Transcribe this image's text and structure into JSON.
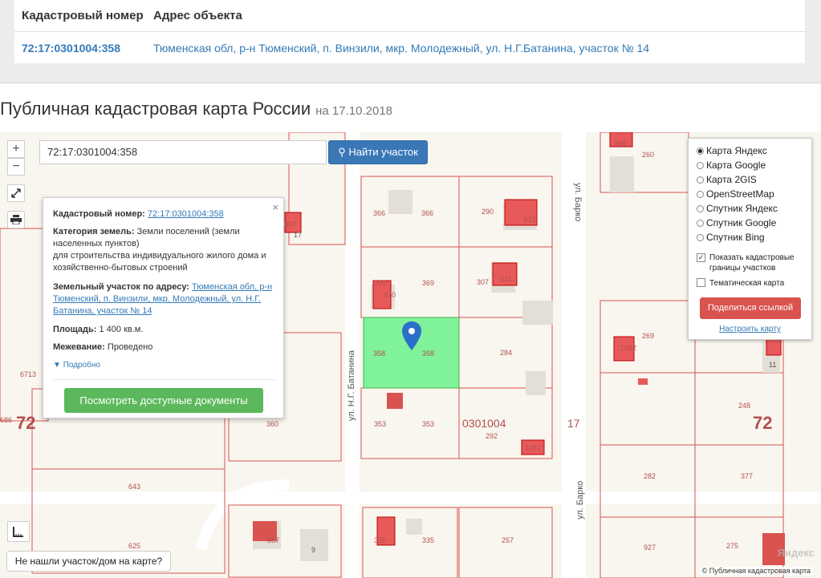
{
  "table": {
    "col_number": "Кадастровый номер",
    "col_address": "Адрес объекта",
    "row_number": "72:17:0301004:358",
    "row_address": "Тюменская обл, р-н Тюменский, п. Винзили, мкр. Молодежный, ул. Н.Г.Батанина, участок № 14"
  },
  "heading": {
    "title": "Публичная кадастровая карта России",
    "date": "на 17.10.2018"
  },
  "search": {
    "value": "72:17:0301004:358",
    "button": "Найти участок",
    "button_icon": "search-icon"
  },
  "zoom": {
    "plus": "+",
    "minus": "−"
  },
  "popup": {
    "close": "×",
    "number_label": "Кадастровый номер:",
    "number_value": "72:17:0301004:358",
    "category_label": "Категория земель:",
    "category_value": "Земли поселений (земли населенных пунктов)",
    "usage": "для строительства индивидуального жилого дома и хозяйственно-бытовых строений",
    "address_label": "Земельный участок по адресу:",
    "address_value": "Тюменская обл, р-н Тюменский, п. Винзили, мкр. Молодежный, ул. Н.Г. Батанина, участок № 14",
    "area_label": "Площадь:",
    "area_value": "1 400 кв.м.",
    "survey_label": "Межевание:",
    "survey_value": "Проведено",
    "more": "Подробно",
    "docs_button": "Посмотреть доступные документы"
  },
  "layers": {
    "options": [
      "Карта Яндекс",
      "Карта Google",
      "Карта 2GIS",
      "OpenStreetMap",
      "Спутник Яндекс",
      "Спутник Google",
      "Спутник Bing"
    ],
    "selected": "Карта Яндекс",
    "show_borders": "Показать кадастровые границы участков",
    "thematic": "Тематическая карта",
    "share_button": "Поделиться ссылкой",
    "customize": "Настроить карту"
  },
  "map_labels": {
    "street_batanina": "ул. Н.Г. Батанина",
    "street_barko_top": "ул. Барко",
    "street_barko_bottom": "ул. Барко",
    "block": "0301004",
    "quarter_left": "72",
    "quarter_right": "72",
    "district": "17",
    "parcels": [
      "366",
      "366",
      "290",
      "833",
      "369",
      "369",
      "307",
      "831",
      "358",
      "358",
      "284",
      "353",
      "353",
      "292",
      "1081",
      "360",
      "643",
      "625",
      "357",
      "9",
      "335",
      "335",
      "257",
      "269",
      "1082",
      "248",
      "282",
      "377",
      "927",
      "275",
      "11",
      "260",
      "886",
      "857",
      "17",
      "6713",
      "686",
      "870"
    ]
  },
  "not_found": "Не нашли участок/дом на карте?",
  "copyright": "© Публичная кадастровая карта",
  "watermark": "Яндекс"
}
